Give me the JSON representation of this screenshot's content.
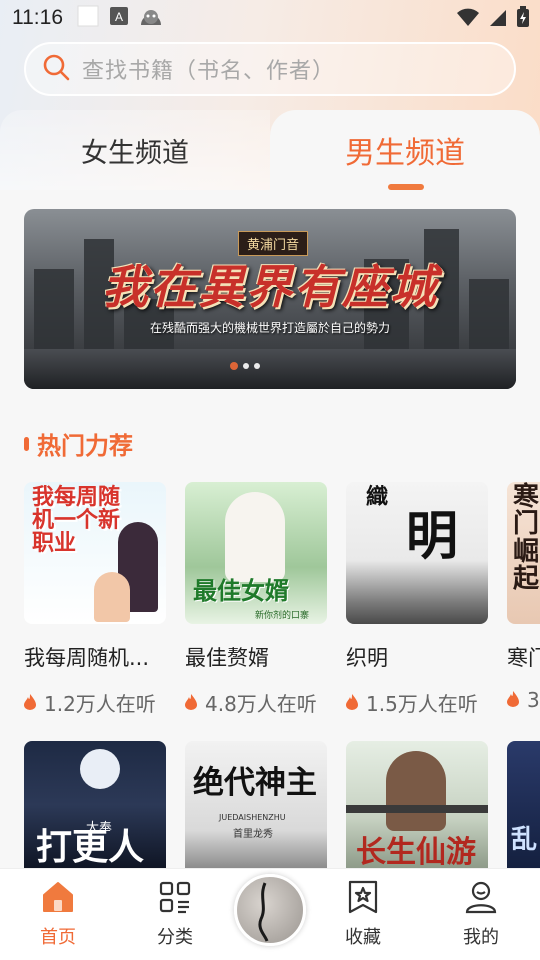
{
  "status": {
    "time": "11:16",
    "icons": [
      "notification-square-icon",
      "a-text-icon",
      "android-icon",
      "wifi-icon",
      "cellular-signal-icon",
      "battery-charging-icon"
    ]
  },
  "search": {
    "placeholder": "查找书籍（书名、作者）",
    "icon": "search-icon"
  },
  "tabs": [
    {
      "label": "女生频道",
      "active": false
    },
    {
      "label": "男生频道",
      "active": true
    }
  ],
  "banner": {
    "tag": "黄浦门音",
    "title": "我在異界有座城",
    "subtitle": "在残酷而强大的機械世界打造屬於自己的勢力",
    "slide_count": 3,
    "active_slide": 0
  },
  "section": {
    "title": "热门力荐"
  },
  "books_row1": [
    {
      "title": "我每周随机...",
      "listeners": "1.2万人在听",
      "cover_text": "我每周随机一个新职业"
    },
    {
      "title": "最佳赘婿",
      "listeners": "4.8万人在听",
      "cover_text": "最佳女婿",
      "cover_sub": "新你剂的口寨"
    },
    {
      "title": "织明",
      "listeners": "1.5万人在听",
      "cover_text": "織明"
    },
    {
      "title": "寒门",
      "listeners": "3",
      "cover_text": "寒门崛起"
    }
  ],
  "books_row2": [
    {
      "cover_text": "打更人",
      "cover_sub": "大奉"
    },
    {
      "cover_text": "绝代神主",
      "cover_sub": "JUEDAISHENZHU",
      "cover_author": "首里龙秀"
    },
    {
      "cover_text": "长生仙游"
    },
    {
      "cover_text": "乱"
    }
  ],
  "nav": [
    {
      "label": "首页",
      "icon": "home-icon",
      "active": true
    },
    {
      "label": "分类",
      "icon": "category-grid-icon",
      "active": false
    },
    {
      "label": "收藏",
      "icon": "bookmark-star-icon",
      "active": false
    },
    {
      "label": "我的",
      "icon": "profile-icon",
      "active": false
    }
  ],
  "colors": {
    "accent": "#f06a36",
    "text": "#222222",
    "muted": "#666666"
  }
}
